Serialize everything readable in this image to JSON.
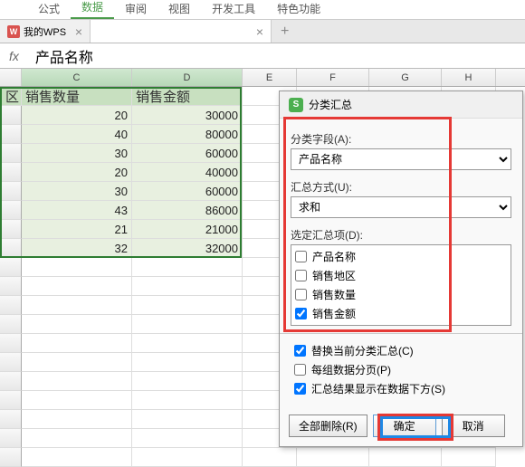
{
  "ribbon": {
    "tabs": [
      "公式",
      "数据",
      "审阅",
      "视图",
      "开发工具",
      "特色功能"
    ],
    "active_index": 1
  },
  "doc_tabs": {
    "tab1": "我的WPS",
    "tab2": ""
  },
  "formula_bar": {
    "fx": "fx",
    "value": "产品名称"
  },
  "columns": [
    "C",
    "D",
    "E",
    "F",
    "G",
    "H"
  ],
  "headers": {
    "partial": "区",
    "c": "销售数量",
    "d": "销售金额"
  },
  "chart_data": {
    "type": "table",
    "columns": [
      "销售数量",
      "销售金额"
    ],
    "rows": [
      {
        "销售数量": 20,
        "销售金额": 30000
      },
      {
        "销售数量": 40,
        "销售金额": 80000
      },
      {
        "销售数量": 30,
        "销售金额": 60000
      },
      {
        "销售数量": 20,
        "销售金额": 40000
      },
      {
        "销售数量": 30,
        "销售金额": 60000
      },
      {
        "销售数量": 43,
        "销售金额": 86000
      },
      {
        "销售数量": 21,
        "销售金额": 21000
      },
      {
        "销售数量": 32,
        "销售金额": 32000
      }
    ]
  },
  "dialog": {
    "title": "分类汇总",
    "group_field_label": "分类字段(A):",
    "group_field_value": "产品名称",
    "summary_fn_label": "汇总方式(U):",
    "summary_fn_value": "求和",
    "selected_items_label": "选定汇总项(D):",
    "items": [
      {
        "label": "产品名称",
        "checked": false
      },
      {
        "label": "销售地区",
        "checked": false
      },
      {
        "label": "销售数量",
        "checked": false
      },
      {
        "label": "销售金额",
        "checked": true
      }
    ],
    "opts": [
      {
        "label": "替换当前分类汇总(C)",
        "checked": true
      },
      {
        "label": "每组数据分页(P)",
        "checked": false
      },
      {
        "label": "汇总结果显示在数据下方(S)",
        "checked": true
      }
    ],
    "buttons": {
      "delete_all": "全部删除(R)",
      "ok": "确定",
      "cancel": "取消"
    }
  }
}
